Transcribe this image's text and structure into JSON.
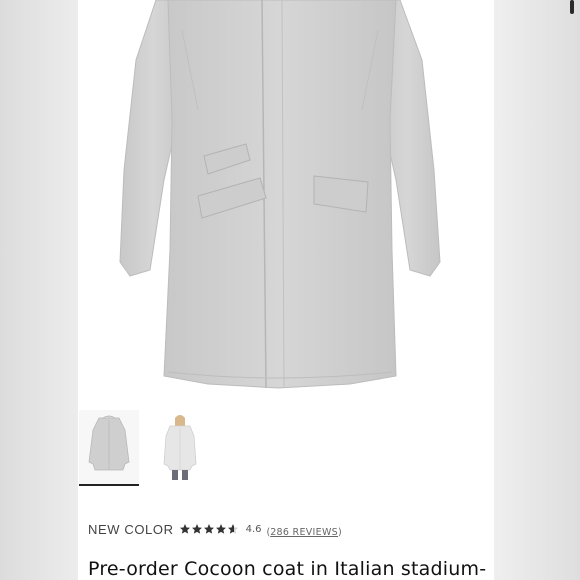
{
  "product": {
    "badge": "NEW COLOR",
    "rating_value": "4.6",
    "stars_filled": 4.6,
    "stars_total": 5,
    "reviews_label": "286 REVIEWS",
    "title": "Pre-order Cocoon coat in Italian stadium-"
  },
  "gallery": {
    "thumbnails": [
      {
        "name": "front view",
        "selected": true
      },
      {
        "name": "model view",
        "selected": false
      }
    ]
  },
  "colors": {
    "coat": "#cfcfcf",
    "coat_shadow": "#b9b9b9",
    "star": "#333333",
    "active_underline": "#222222"
  }
}
